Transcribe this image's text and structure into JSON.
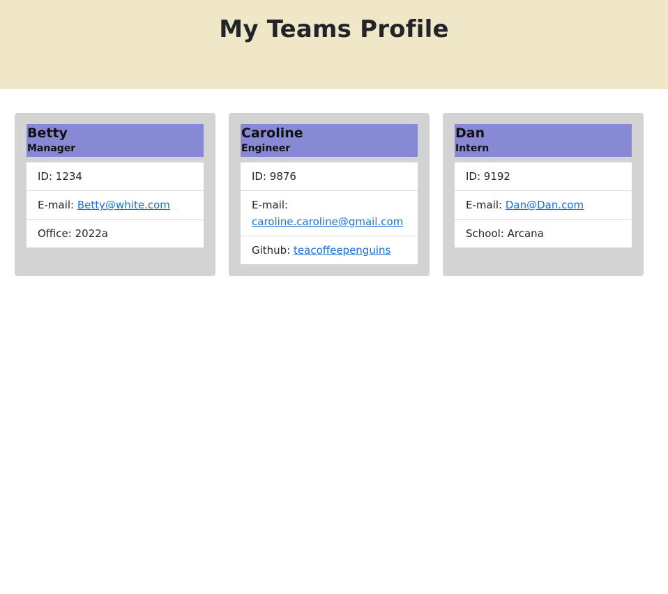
{
  "page": {
    "title": "My Teams Profile"
  },
  "cards": [
    {
      "name": "Betty",
      "role": "Manager",
      "id_label": "ID: ",
      "id_value": "1234",
      "email_label": "E-mail: ",
      "email": "Betty@white.com",
      "extra_label": "Office: ",
      "extra_value": "2022a"
    },
    {
      "name": "Caroline",
      "role": "Engineer",
      "id_label": "ID: ",
      "id_value": "9876",
      "email_label": "E-mail: ",
      "email": "caroline.caroline@gmail.com",
      "extra_label": "Github: ",
      "extra_value": "teacoffeepenguins"
    },
    {
      "name": "Dan",
      "role": "Intern",
      "id_label": "ID: ",
      "id_value": "9192",
      "email_label": "E-mail: ",
      "email": "Dan@Dan.com",
      "extra_label": "School: ",
      "extra_value": "Arcana"
    }
  ],
  "colors": {
    "header_bg": "#f0e6c8",
    "card_bg": "#d3d3d3",
    "card_head_bg": "#8789d5",
    "link": "#1a6fd6"
  }
}
